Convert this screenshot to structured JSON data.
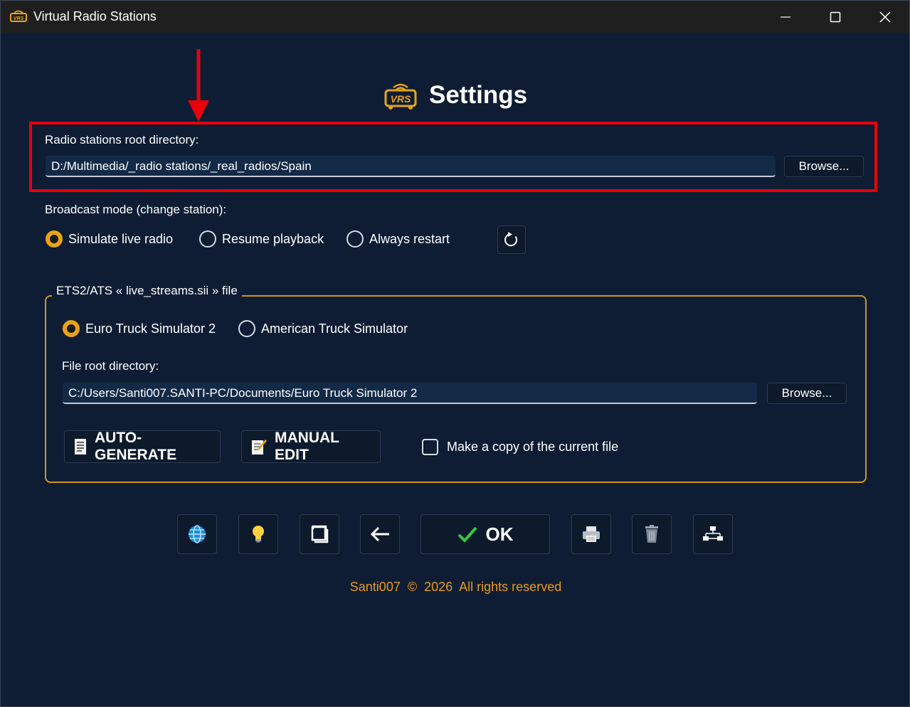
{
  "window": {
    "title": "Virtual Radio Stations",
    "minimize_icon": "minimize-icon",
    "maximize_icon": "maximize-icon",
    "close_icon": "close-icon"
  },
  "header": {
    "logo_text": "VRS",
    "title": "Settings"
  },
  "radio_root": {
    "label": "Radio stations root directory:",
    "value": "D:/Multimedia/_radio stations/_real_radios/Spain",
    "browse_label": "Browse..."
  },
  "broadcast_mode": {
    "label": "Broadcast mode (change station):",
    "options": [
      {
        "label": "Simulate live radio",
        "selected": true
      },
      {
        "label": "Resume playback",
        "selected": false
      },
      {
        "label": "Always restart",
        "selected": false
      }
    ],
    "reset_icon": "refresh-icon"
  },
  "live_streams": {
    "group_title": "ETS2/ATS « live_streams.sii » file",
    "games": [
      {
        "label": "Euro Truck Simulator 2",
        "selected": true
      },
      {
        "label": "American Truck Simulator",
        "selected": false
      }
    ],
    "root_label": "File root directory:",
    "root_value": "C:/Users/Santi007.SANTI-PC/Documents/Euro Truck Simulator 2",
    "browse_label": "Browse...",
    "auto_generate_label": "AUTO-GENERATE",
    "manual_edit_label": "MANUAL EDIT",
    "copy_label": "Make a copy of the current file",
    "copy_checked": false
  },
  "toolbar": {
    "icons": [
      "globe-icon",
      "lightbulb-icon",
      "window-icon",
      "back-arrow-icon",
      "printer-icon",
      "trash-icon",
      "network-icon"
    ],
    "ok_label": "OK"
  },
  "footer": {
    "text": "Santi007  ©  2026  All rights reserved"
  },
  "colors": {
    "background": "#0e1d33",
    "accent_orange": "#e8a317",
    "highlight_red": "#e8000b",
    "ok_green": "#2ecc40"
  }
}
